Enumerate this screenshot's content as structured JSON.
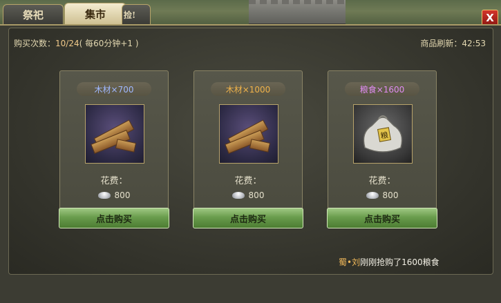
{
  "tabs": {
    "sacrifice": "祭祀",
    "market": "集市",
    "partial": "捡!"
  },
  "close_label": "X",
  "header": {
    "purchase_count_label": "购买次数：",
    "purchase_count_value": "10/24",
    "purchase_count_note": "( 每60分钟+1 )",
    "refresh_label": "商品刷新：",
    "refresh_time": "42:53"
  },
  "items": [
    {
      "name": "木材×700",
      "name_color": "#9fb8ff",
      "cost_label": "花费：",
      "price": "800",
      "buy_label": "点击购买",
      "icon": "wood-icon"
    },
    {
      "name": "木材×1000",
      "name_color": "#f0b34a",
      "cost_label": "花费：",
      "price": "800",
      "buy_label": "点击购买",
      "icon": "wood-icon"
    },
    {
      "name": "粮食×1600",
      "name_color": "#e08cf2",
      "cost_label": "花费：",
      "price": "800",
      "buy_label": "点击购买",
      "icon": "grain-sack-icon"
    }
  ],
  "feed": {
    "player": "蜀•刘",
    "message": "刚刚抢购了1600粮食"
  }
}
